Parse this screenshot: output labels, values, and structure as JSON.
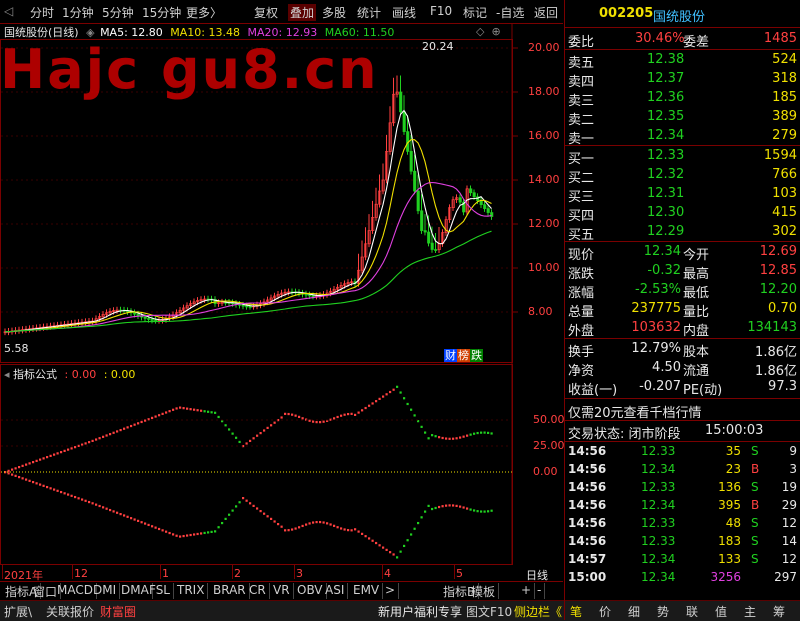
{
  "toolbar": {
    "items": [
      "分时",
      "1分钟",
      "5分钟",
      "15分钟",
      "更多〉",
      "复权",
      "叠加",
      "多股",
      "统计",
      "画线",
      "F10",
      "标记",
      "-自选",
      "返回"
    ]
  },
  "header": {
    "code": "002205",
    "name": "国统股份"
  },
  "ma_bar": {
    "title": "国统股份(日线)",
    "ma5": "MA5: 12.80",
    "ma10": "MA10: 13.48",
    "ma20": "MA20: 12.93",
    "ma60": "MA60: 11.50"
  },
  "watermark": "Hajc gu8.cn",
  "price_axis": [
    "20.00",
    "18.00",
    "16.00",
    "14.00",
    "12.00",
    "10.00",
    "8.00"
  ],
  "high_label": "20.24",
  "low_label": "5.58",
  "fin_tags": [
    "财",
    "榜",
    "跌"
  ],
  "indicator": {
    "title": "指标公式",
    "v1": ": 0.00",
    "v2": ": 0.00"
  },
  "ind_axis": [
    "50.00",
    "25.00",
    "0.00"
  ],
  "date_axis": [
    "2021年",
    "12",
    "1",
    "2",
    "3",
    "4",
    "5"
  ],
  "date_axis_right": "日线",
  "bottom_tabs": [
    "指标A",
    "窗口",
    "MACD",
    "DMI",
    "DMA",
    "FSL",
    "TRIX",
    "BRAR",
    "CR",
    "VR",
    "OBV",
    "ASI",
    "EMV",
    ">",
    "指标B",
    "模板",
    "+",
    "-"
  ],
  "status_bar": {
    "left": [
      "扩展\\",
      "关联报价",
      "财富圈"
    ],
    "promo": "新用户福利专享",
    "tabs": [
      "图文F10",
      "侧边栏《"
    ],
    "right": [
      "笔",
      "价",
      "细",
      "势",
      "联",
      "值",
      "主",
      "筹"
    ]
  },
  "wei": {
    "label1": "委比",
    "v1": "30.46%",
    "label2": "委差",
    "v2": "1485"
  },
  "sells": [
    {
      "label": "卖五",
      "price": "12.38",
      "vol": "524"
    },
    {
      "label": "卖四",
      "price": "12.37",
      "vol": "318"
    },
    {
      "label": "卖三",
      "price": "12.36",
      "vol": "185"
    },
    {
      "label": "卖二",
      "price": "12.35",
      "vol": "389"
    },
    {
      "label": "卖一",
      "price": "12.34",
      "vol": "279"
    }
  ],
  "buys": [
    {
      "label": "买一",
      "price": "12.33",
      "vol": "1594"
    },
    {
      "label": "买二",
      "price": "12.32",
      "vol": "766"
    },
    {
      "label": "买三",
      "price": "12.31",
      "vol": "103"
    },
    {
      "label": "买四",
      "price": "12.30",
      "vol": "415"
    },
    {
      "label": "买五",
      "price": "12.29",
      "vol": "302"
    }
  ],
  "quote": [
    {
      "l1": "现价",
      "v1": "12.34",
      "l2": "今开",
      "v2": "12.69"
    },
    {
      "l1": "涨跌",
      "v1": "-0.32",
      "l2": "最高",
      "v2": "12.85"
    },
    {
      "l1": "涨幅",
      "v1": "-2.53%",
      "l2": "最低",
      "v2": "12.20"
    },
    {
      "l1": "总量",
      "v1": "237775",
      "l2": "量比",
      "v2": "0.70"
    },
    {
      "l1": "外盘",
      "v1": "103632",
      "l2": "内盘",
      "v2": "134143"
    }
  ],
  "quote2": [
    {
      "l1": "换手",
      "v1": "12.79%",
      "l2": "股本",
      "v2": "1.86亿"
    },
    {
      "l1": "净资",
      "v1": "4.50",
      "l2": "流通",
      "v2": "1.86亿"
    },
    {
      "l1": "收益(一)",
      "v1": "-0.207",
      "l2": "PE(动)",
      "v2": "97.3"
    }
  ],
  "promo_line": "仅需20元查看千档行情",
  "trade_status": {
    "label": "交易状态: 闭市阶段",
    "time": "15:00:03"
  },
  "ticks": [
    {
      "time": "14:56",
      "price": "12.33",
      "vol": "35",
      "bs": "S",
      "n": "9"
    },
    {
      "time": "14:56",
      "price": "12.34",
      "vol": "23",
      "bs": "B",
      "n": "3"
    },
    {
      "time": "14:56",
      "price": "12.33",
      "vol": "136",
      "bs": "S",
      "n": "19"
    },
    {
      "time": "14:56",
      "price": "12.34",
      "vol": "395",
      "bs": "B",
      "n": "29"
    },
    {
      "time": "14:56",
      "price": "12.33",
      "vol": "48",
      "bs": "S",
      "n": "12"
    },
    {
      "time": "14:56",
      "price": "12.33",
      "vol": "183",
      "bs": "S",
      "n": "14"
    },
    {
      "time": "14:57",
      "price": "12.34",
      "vol": "133",
      "bs": "S",
      "n": "12"
    },
    {
      "time": "15:00",
      "price": "12.34",
      "vol": "3256",
      "bs": "",
      "n": "297"
    }
  ],
  "colors": {
    "up": "#ff4040",
    "down": "#20d020",
    "ma5": "#ffffff",
    "ma10": "#f0e000",
    "ma20": "#e040e0",
    "ma60": "#20d020",
    "frame": "#7a0000"
  }
}
